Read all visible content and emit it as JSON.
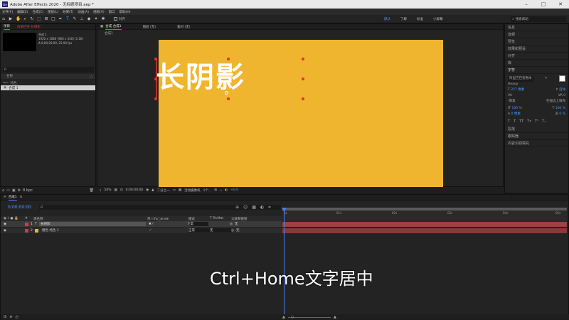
{
  "window": {
    "title": "Adobe After Effects 2020 - 无标题项目.aep *",
    "logo": "Ae"
  },
  "menu": [
    "文件(F)",
    "编辑(E)",
    "合成(C)",
    "图层(L)",
    "效果(T)",
    "动画(A)",
    "视图(V)",
    "窗口",
    "帮助(H)"
  ],
  "toolbar": {
    "snap_label": "对齐",
    "workspaces": [
      "默认",
      "了解",
      "标准",
      "小屏幕"
    ],
    "search_placeholder": "搜索帮助"
  },
  "project": {
    "tab_project": "项目",
    "tab_effects": "效果控件 长阴影",
    "comp_name": "合成 1",
    "comp_info_1": "1920 x 1080 (960 x 540) (1.00)",
    "comp_info_2": "Δ 0;00;20;00, 25.00 fps",
    "search_placeholder": "ρ",
    "col_name": "名称",
    "items": [
      {
        "name": "纯色",
        "type": "folder"
      },
      {
        "name": "合成 1",
        "type": "comp"
      }
    ]
  },
  "viewer": {
    "tabs": [
      "合成 合成1",
      "图层 (无)",
      "素材 (无)"
    ],
    "sub_tab": "合成1",
    "headline": "长阴影",
    "zoom": "50%",
    "timecode": "0:00:00:00",
    "resolution": "二分之一",
    "camera": "活动摄像机",
    "views": "1个...",
    "exposure": "+0.0"
  },
  "right_panel": {
    "items": [
      "信息",
      "音频",
      "预览",
      "效果和预设",
      "对齐",
      "库",
      "字符",
      "段落",
      "跟踪器",
      "内容识别填充"
    ],
    "character": {
      "font": "阿里巴巴普惠体",
      "style": "Heavy",
      "size": "227 像素",
      "leading": "自动",
      "tracking": "0",
      "stroke": "在描边上填充",
      "stroke_width": "-像素",
      "scale_v": "100 %",
      "scale_h": "100 %",
      "baseline": "0 像素",
      "tsume": "0 %"
    }
  },
  "timeline": {
    "tab": "合成1",
    "timecode": "0:00:00:00",
    "col_headers": [
      "#",
      "源名称",
      "单☆\\fx□⊘⊙⊕",
      "模式",
      "T TrkMat",
      "父级和链接"
    ],
    "layers": [
      {
        "index": "1",
        "name": "长阴影",
        "mode": "正常",
        "parent": "无",
        "color": "#c94040"
      },
      {
        "index": "2",
        "name": "橙色 纯色 1",
        "mode": "正常",
        "trkmat": "无",
        "parent": "无",
        "color": "#c94040"
      }
    ],
    "ruler": [
      "0s",
      "01s",
      "02s",
      "03s",
      "04s",
      "05s"
    ]
  },
  "subtitle": "Ctrl+Home文字居中",
  "colors": {
    "canvas": "#f0b52e",
    "track": "#a04040",
    "accent": "#4b7bec"
  }
}
